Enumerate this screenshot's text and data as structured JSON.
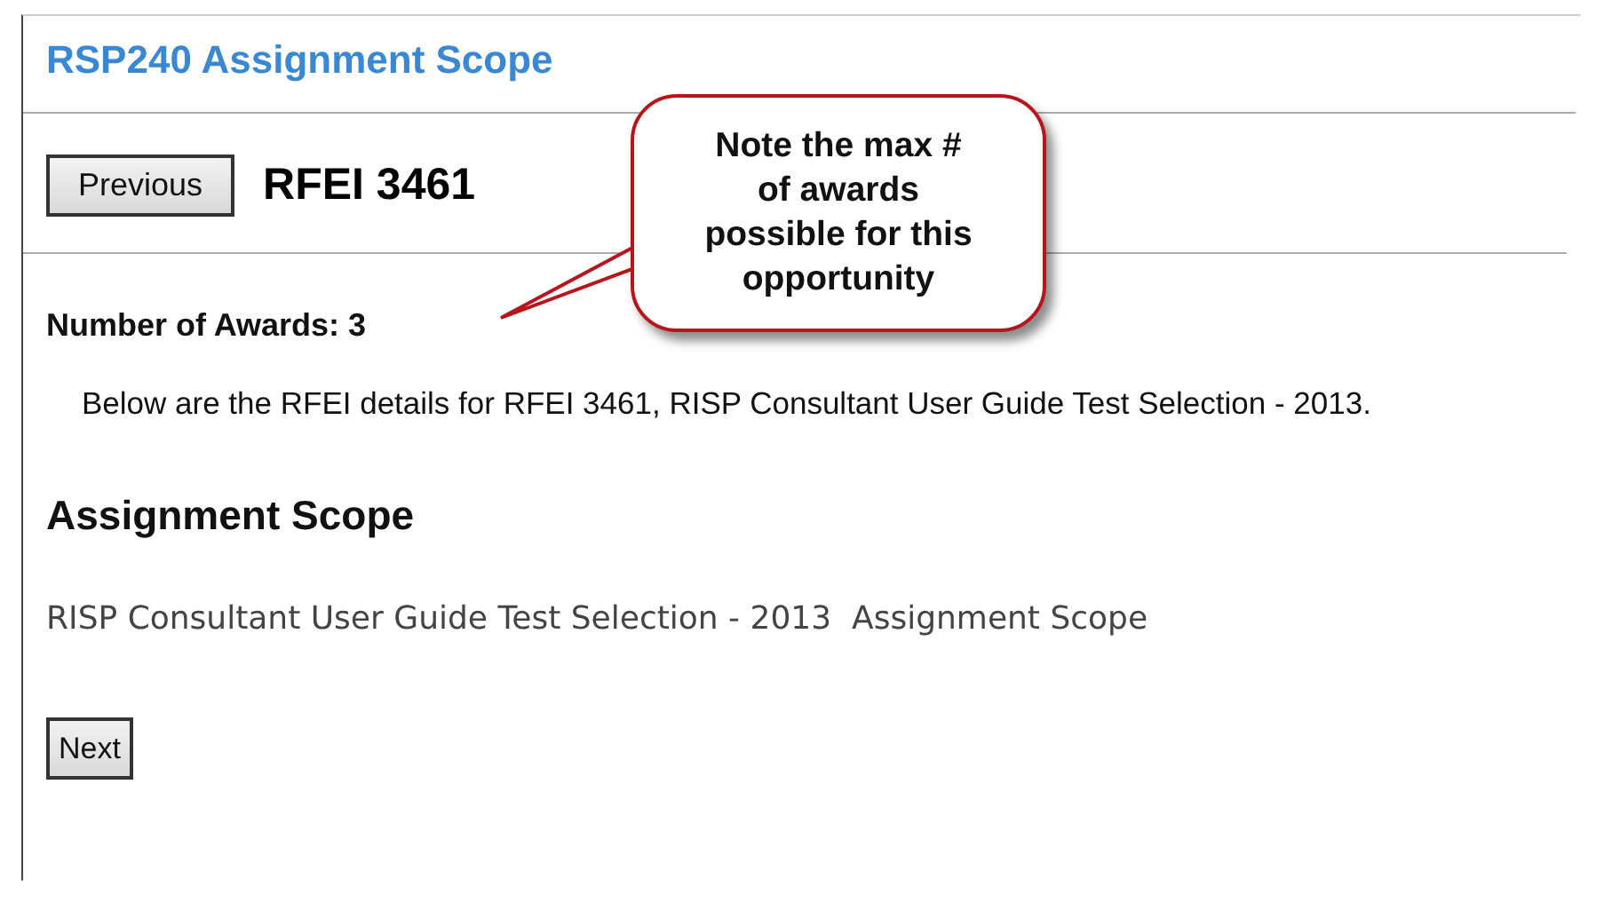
{
  "page": {
    "title": "RSP240 Assignment Scope"
  },
  "navigation": {
    "previous_button": "Previous",
    "heading": "RFEI 3461"
  },
  "awards": {
    "label": "Number of Awards: 3"
  },
  "intro": "Below are the RFEI details for RFEI 3461, RISP Consultant User Guide Test Selection - 2013.",
  "section": {
    "heading": "Assignment Scope",
    "body": "RISP Consultant User Guide Test Selection - 2013  Assignment Scope"
  },
  "next_button": "Next",
  "callout": {
    "lines": [
      "Note the max #",
      "of awards",
      "possible for this",
      "opportunity"
    ]
  }
}
